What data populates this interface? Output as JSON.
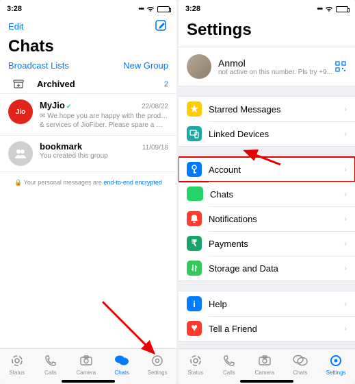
{
  "status": {
    "time": "3:28"
  },
  "chats_screen": {
    "edit": "Edit",
    "title": "Chats",
    "broadcast": "Broadcast Lists",
    "newgroup": "New Group",
    "archived": {
      "label": "Archived",
      "count": "2"
    },
    "chats": [
      {
        "name": "MyJio",
        "date": "22/08/22",
        "sub1": "✉ We hope you are happy with the products",
        "sub2": "& services of JioFiber. Please spare a mom..."
      },
      {
        "name": "bookmark",
        "date": "11/09/18",
        "sub1": "You created this group"
      }
    ],
    "e2e_prefix": "🔒 Your personal messages are ",
    "e2e_link": "end-to-end encrypted"
  },
  "settings_screen": {
    "title": "Settings",
    "profile": {
      "name": "Anmol",
      "sub": "not active on this number. Pls try +9..."
    },
    "rows": {
      "starred": "Starred Messages",
      "linked": "Linked Devices",
      "account": "Account",
      "chats": "Chats",
      "notif": "Notifications",
      "pay": "Payments",
      "storage": "Storage and Data",
      "help": "Help",
      "tell": "Tell a Friend"
    }
  },
  "tabs": {
    "status": "Status",
    "calls": "Calls",
    "camera": "Camera",
    "chats": "Chats",
    "settings": "Settings"
  }
}
